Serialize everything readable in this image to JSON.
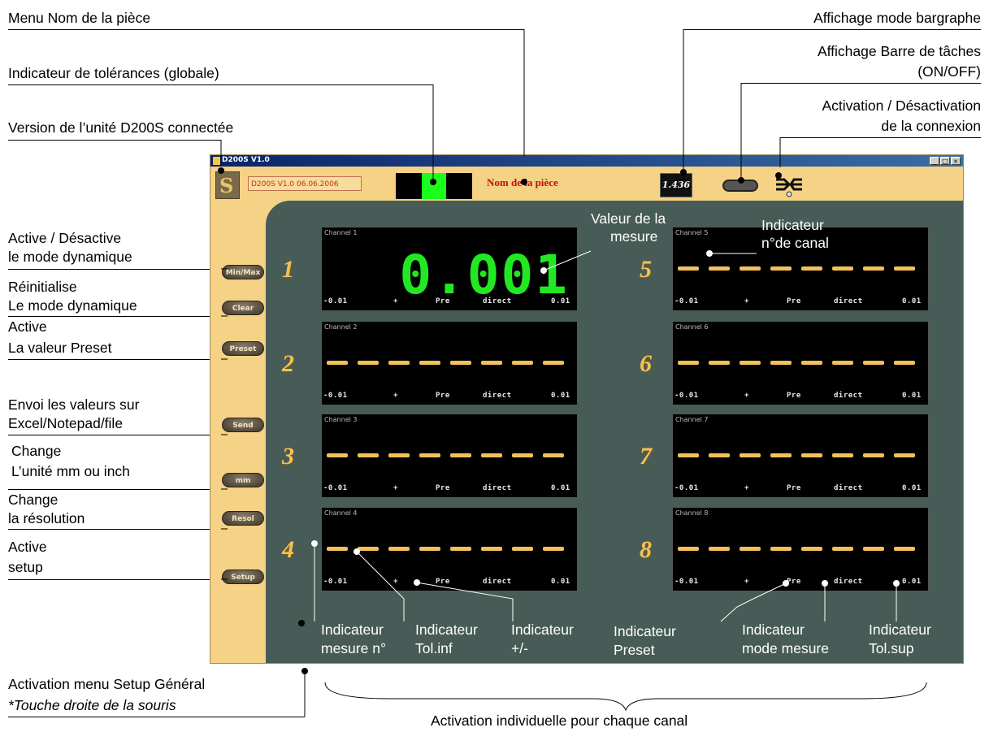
{
  "annotations": {
    "piece_menu": "Menu Nom de la pièce",
    "tolerance_indicator": "Indicateur de tolérances (globale)",
    "unit_version": "Version de l’unité D200S connectée",
    "bargraph_mode": "Affichage mode bargraphe",
    "taskbar_line1": "Affichage Barre de tâches",
    "taskbar_line2": "(ON/OFF)",
    "connection_line1": "Activation / Désactivation",
    "connection_line2": "de la connexion",
    "dynamic_line1": "Active / Désactive",
    "dynamic_line2": "le mode dynamique",
    "reset_line1": "Réinitialise",
    "reset_line2": "Le mode dynamique",
    "preset_line1": "Active",
    "preset_line2": "La valeur Preset",
    "send_line1": "Envoi les valeurs sur",
    "send_line2": "Excel/Notepad/file",
    "unit_line1": "Change",
    "unit_line2": "L’unité mm ou inch",
    "resol_line1": "Change",
    "resol_line2": "la résolution",
    "setup_line1": "Active",
    "setup_line2": "setup",
    "general_setup_line1": "Activation menu Setup Général",
    "general_setup_line2": "*Touche droite de la souris",
    "individual_activation": "Activation individuelle pour chaque canal",
    "measure_value_line1": "Valeur de la",
    "measure_value_line2": "mesure",
    "channel_indicator_line1": "Indicateur",
    "channel_indicator_line2": "n°de canal",
    "ind_mesure_line1": "Indicateur",
    "ind_mesure_line2": "mesure n°",
    "ind_tolinf_line1": "Indicateur",
    "ind_tolinf_line2": "Tol.inf",
    "ind_pm_line1": "Indicateur",
    "ind_pm_line2": "+/-",
    "ind_preset_line1": "Indicateur",
    "ind_preset_line2": "Preset",
    "ind_mode_line1": "Indicateur",
    "ind_mode_line2": "mode mesure",
    "ind_tolsup_line1": "Indicateur",
    "ind_tolsup_line2": "Tol.sup"
  },
  "app": {
    "title": "D200S V1.0",
    "version_text": "D200S V1.0 06.06.2006",
    "piece_name": "Nom de la pièce",
    "bargraph_value": "1.436",
    "window_buttons": [
      "_",
      "□",
      "×"
    ],
    "side_buttons": [
      "Min/Max",
      "Clear",
      "Preset",
      "Send",
      "mm",
      "Resol",
      "Setup"
    ],
    "channels": [
      {
        "number": "1",
        "label": "Channel 1",
        "value": "0.001",
        "tol_inf": "-0.01",
        "sign": "+",
        "preset": "Pre",
        "mode": "direct",
        "tol_sup": "0.01"
      },
      {
        "number": "2",
        "label": "Channel 2",
        "value": "",
        "tol_inf": "-0.01",
        "sign": "+",
        "preset": "Pre",
        "mode": "direct",
        "tol_sup": "0.01"
      },
      {
        "number": "3",
        "label": "Channel 3",
        "value": "",
        "tol_inf": "-0.01",
        "sign": "+",
        "preset": "Pre",
        "mode": "direct",
        "tol_sup": "0.01"
      },
      {
        "number": "4",
        "label": "Channel 4",
        "value": "",
        "tol_inf": "-0.01",
        "sign": "+",
        "preset": "Pre",
        "mode": "direct",
        "tol_sup": "0.01"
      },
      {
        "number": "5",
        "label": "Channel 5",
        "value": "",
        "tol_inf": "-0.01",
        "sign": "+",
        "preset": "Pre",
        "mode": "direct",
        "tol_sup": "0.01"
      },
      {
        "number": "6",
        "label": "Channel 6",
        "value": "",
        "tol_inf": "-0.01",
        "sign": "+",
        "preset": "Pre",
        "mode": "direct",
        "tol_sup": "0.01"
      },
      {
        "number": "7",
        "label": "Channel 7",
        "value": "",
        "tol_inf": "-0.01",
        "sign": "+",
        "preset": "Pre",
        "mode": "direct",
        "tol_sup": "0.01"
      },
      {
        "number": "8",
        "label": "Channel 8",
        "value": "",
        "tol_inf": "-0.01",
        "sign": "+",
        "preset": "Pre",
        "mode": "direct",
        "tol_sup": "0.01"
      }
    ]
  },
  "colors": {
    "window_bg": "#f5d285",
    "panel_bg": "#475c56",
    "digit_green": "#22e822",
    "dash_amber": "#f2c15a",
    "piece_name_red": "#c01010"
  },
  "icons": {
    "connection": "connection-plug-icon",
    "logo": "d200s-logo-icon",
    "taskbar": "toggle-pill-icon"
  }
}
